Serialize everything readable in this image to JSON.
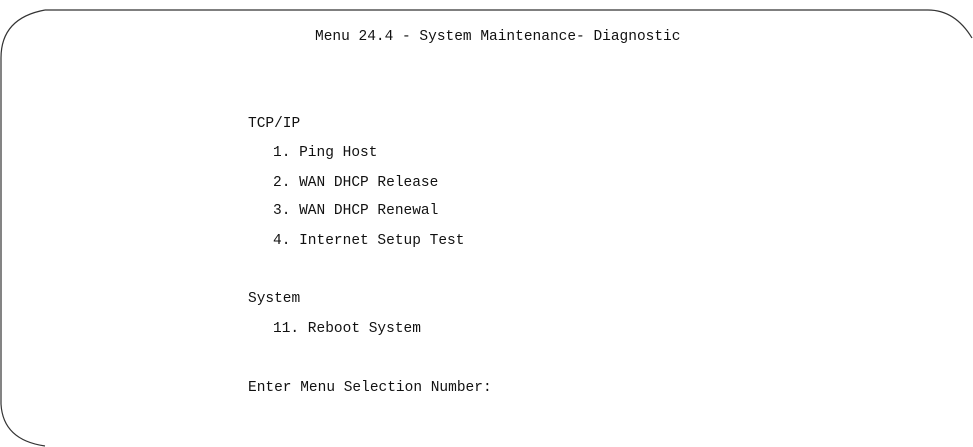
{
  "screen": {
    "title": "Menu 24.4 - System Maintenance- Diagnostic"
  },
  "sections": [
    {
      "heading": "TCP/IP",
      "items": [
        "1. Ping Host",
        "2. WAN DHCP Release",
        "3. WAN DHCP Renewal",
        "4. Internet Setup Test"
      ]
    },
    {
      "heading": "System",
      "items": [
        "11. Reboot System"
      ]
    }
  ],
  "prompt": {
    "label": "Enter Menu Selection Number:",
    "value": ""
  }
}
